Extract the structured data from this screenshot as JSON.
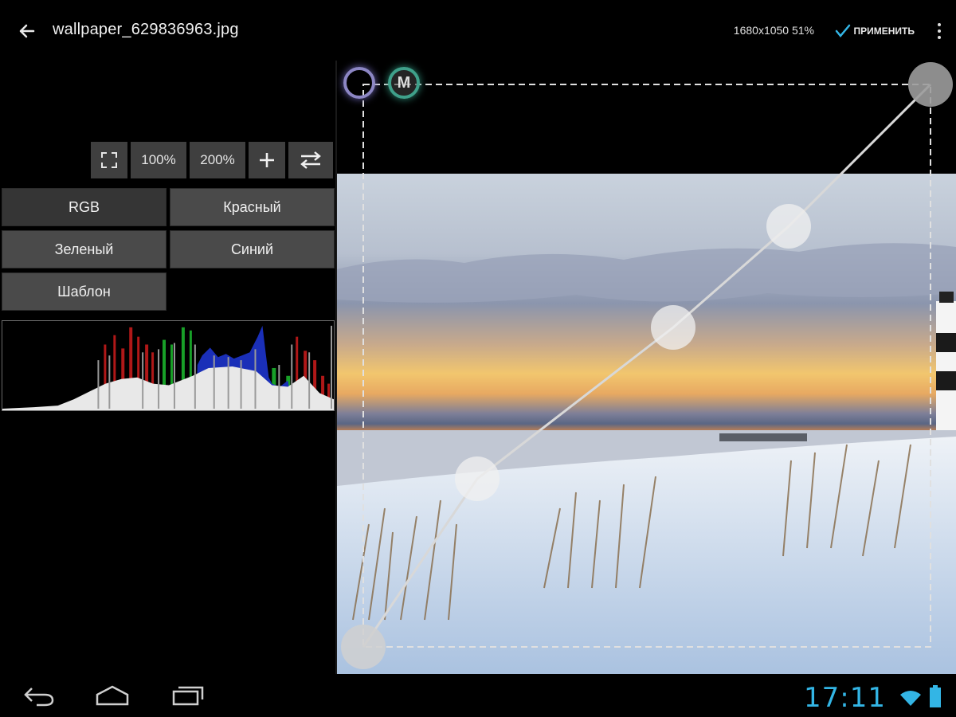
{
  "header": {
    "title": "wallpaper_629836963.jpg",
    "image_info": "1680x1050 51%",
    "apply_label": "ПРИМЕНИТЬ",
    "icons": [
      "back-arrow-icon",
      "checkmark-icon",
      "overflow-menu-icon"
    ]
  },
  "zoom_toolbar": {
    "fit_icon": "fullscreen-icon",
    "zoom_100": "100%",
    "zoom_200": "200%",
    "add_icon": "plus-icon",
    "swap_icon": "swap-icon"
  },
  "channels": {
    "rgb": "RGB",
    "red": "Красный",
    "green": "Зеленый",
    "blue": "Синий",
    "template": "Шаблон",
    "selected": "RGB"
  },
  "curve_badges": {
    "m_label": "M"
  },
  "status_bar": {
    "time": "17:11",
    "icons": [
      "wifi-icon",
      "battery-icon"
    ]
  },
  "nav_bar": {
    "icons": [
      "nav-back-icon",
      "nav-home-icon",
      "nav-recents-icon"
    ]
  },
  "colors": {
    "accent": "#33b5e5",
    "button_bg": "#4a4a4a",
    "toolbar_btn_bg": "#3f3f3f",
    "badge_circle": "#8c86c4",
    "badge_m": "#3fa08a"
  }
}
